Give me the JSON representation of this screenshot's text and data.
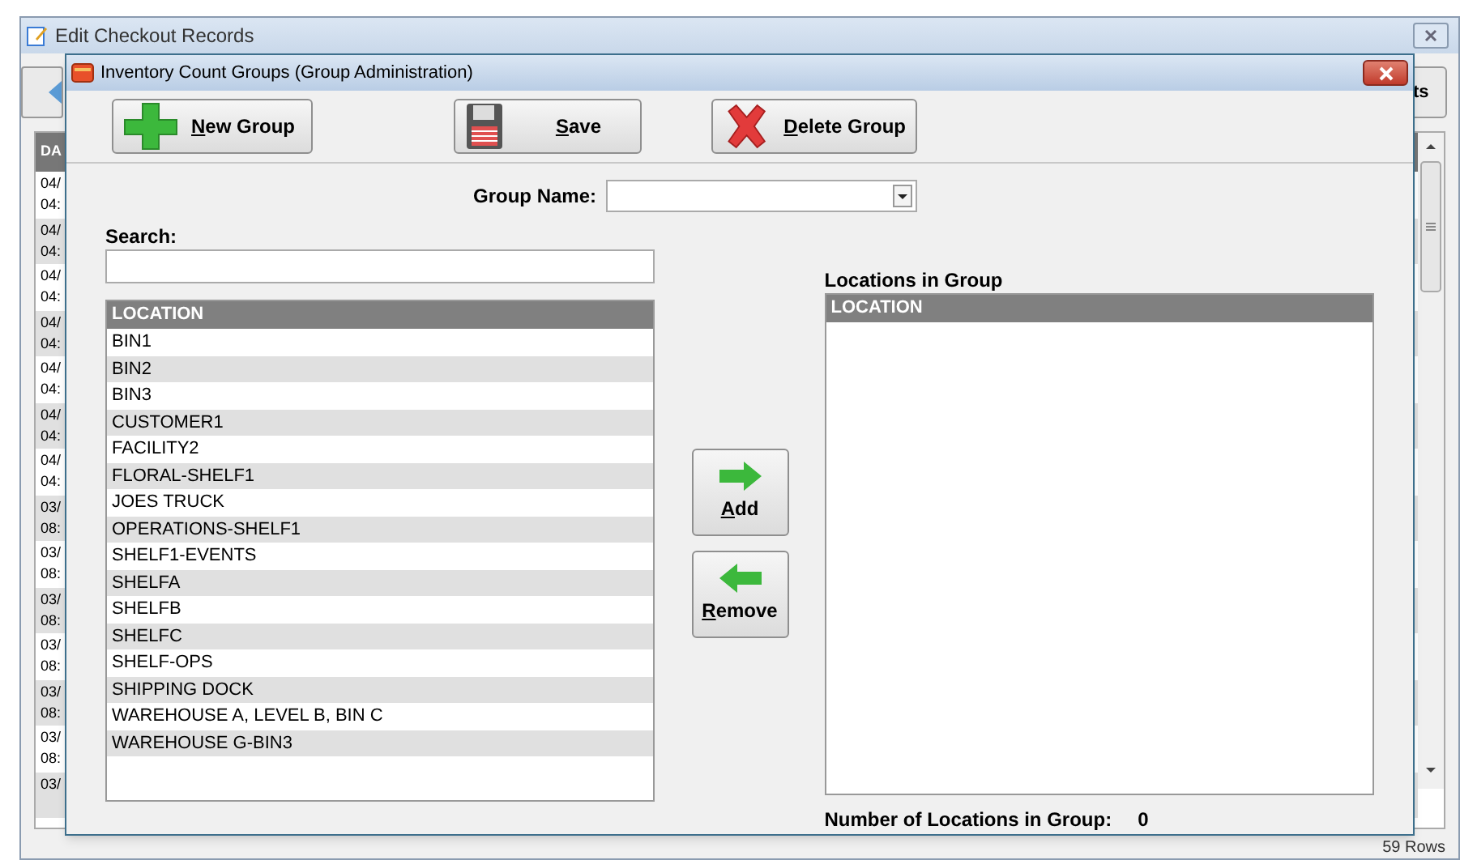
{
  "background_window": {
    "title": "Edit Checkout Records",
    "toolbar_button": "ts",
    "table": {
      "columns": [
        "DA"
      ],
      "rows": [
        {
          "lines": [
            "04/",
            "04:"
          ]
        },
        {
          "lines": [
            "04/",
            "04:"
          ]
        },
        {
          "lines": [
            "04/",
            "04:"
          ]
        },
        {
          "lines": [
            "04/",
            "04:"
          ]
        },
        {
          "lines": [
            "04/",
            "04:"
          ]
        },
        {
          "lines": [
            "04/",
            "04:"
          ]
        },
        {
          "lines": [
            "04/",
            "04:"
          ]
        },
        {
          "lines": [
            "03/",
            "08:"
          ]
        },
        {
          "lines": [
            "03/",
            "08:"
          ]
        },
        {
          "lines": [
            "03/",
            "08:"
          ]
        },
        {
          "lines": [
            "03/",
            "08:"
          ]
        },
        {
          "lines": [
            "03/",
            "08:"
          ]
        },
        {
          "lines": [
            "03/",
            "08:"
          ]
        },
        {
          "lines": [
            "03/"
          ]
        }
      ]
    },
    "status": "59 Rows"
  },
  "dialog": {
    "title": "Inventory Count Groups (Group Administration)",
    "toolbar": [
      {
        "kind": "new",
        "label": "New Group"
      },
      {
        "kind": "save",
        "label": "Save"
      },
      {
        "kind": "delete",
        "label": "Delete Group"
      }
    ],
    "group_name": {
      "label": "Group Name:"
    },
    "search": {
      "label": "Search:"
    },
    "available": {
      "columns": [
        "LOCATION"
      ],
      "rows": [
        "BIN1",
        "BIN2",
        "BIN3",
        "CUSTOMER1",
        "FACILITY2",
        "FLORAL-SHELF1",
        "JOES TRUCK",
        "OPERATIONS-SHELF1",
        "SHELF1-EVENTS",
        "SHELFA",
        "SHELFB",
        "SHELFC",
        "SHELF-OPS",
        "SHIPPING DOCK",
        "WAREHOUSE A, LEVEL B, BIN C",
        "WAREHOUSE G-BIN3"
      ]
    },
    "move_buttons": [
      {
        "kind": "add",
        "label": "Add"
      },
      {
        "kind": "remove",
        "label": "Remove"
      }
    ],
    "in_group": {
      "title": "Locations in Group",
      "columns": [
        "LOCATION"
      ]
    },
    "count": {
      "label": "Number of Locations in Group:",
      "value": "0"
    }
  }
}
